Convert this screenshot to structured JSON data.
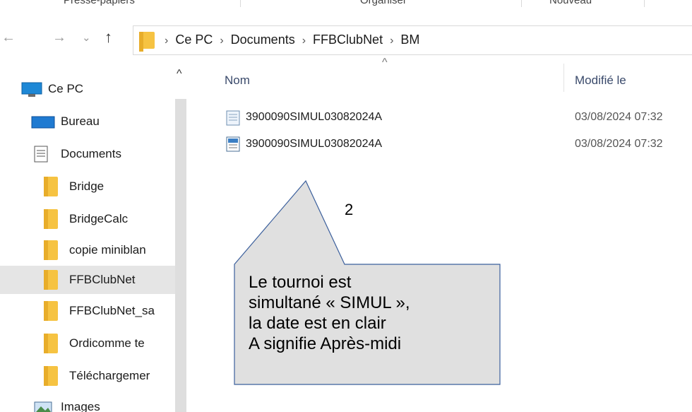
{
  "ribbon": {
    "groups": [
      "Presse-papiers",
      "Organiser",
      "Nouveau"
    ]
  },
  "nav_buttons": {
    "back": "back-arrow-icon",
    "forward": "forward-arrow-icon",
    "recent": "chevron-down-icon",
    "up": "up-arrow-icon"
  },
  "address_bar": {
    "crumbs": [
      "Ce PC",
      "Documents",
      "FFBClubNet",
      "BM"
    ]
  },
  "nav_pane": {
    "items": [
      {
        "label": "Ce PC",
        "icon": "computer-icon"
      },
      {
        "label": "Bureau",
        "icon": "desktop-icon"
      },
      {
        "label": "Documents",
        "icon": "documents-icon"
      },
      {
        "label": "Bridge",
        "icon": "folder-icon"
      },
      {
        "label": "BridgeCalc",
        "icon": "folder-icon"
      },
      {
        "label": "copie miniblan",
        "icon": "folder-icon"
      },
      {
        "label": "FFBClubNet",
        "icon": "folder-icon",
        "selected": true
      },
      {
        "label": "FFBClubNet_sa",
        "icon": "folder-icon"
      },
      {
        "label": "Ordicomme te",
        "icon": "folder-icon"
      },
      {
        "label": "Téléchargemer",
        "icon": "folder-icon"
      },
      {
        "label": "Images",
        "icon": "images-icon"
      }
    ]
  },
  "file_list": {
    "columns": [
      "Nom",
      "Modifié le"
    ],
    "rows": [
      {
        "name": "3900090SIMUL03082024A",
        "modified": "03/08/2024 07:32",
        "icon": "text-file-icon"
      },
      {
        "name": "3900090SIMUL03082024A",
        "modified": "03/08/2024 07:32",
        "icon": "config-file-icon"
      }
    ]
  },
  "annotation": {
    "number": "2",
    "lines": [
      "Le tournoi est",
      "simultané « SIMUL »,",
      "la date est en clair",
      "A signifie Après-midi"
    ],
    "colors": {
      "fill": "#e0e0e0",
      "border": "#3b5f9c"
    }
  }
}
